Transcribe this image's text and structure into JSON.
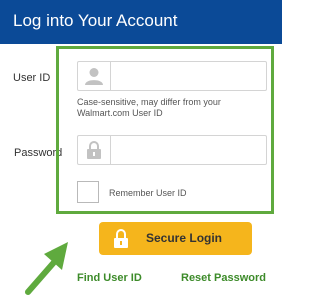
{
  "header": {
    "title": "Log into Your Account"
  },
  "form": {
    "user_id_label": "User ID",
    "user_id_value": "",
    "user_id_hint": "Case-sensitive, may differ from your Walmart.com User ID",
    "password_label": "Password",
    "password_value": "",
    "remember_label": "Remember User ID",
    "remember_checked": false
  },
  "actions": {
    "login_label": "Secure Login",
    "find_user_id": "Find User ID",
    "reset_password": "Reset Password"
  },
  "colors": {
    "header_bg": "#0b4a97",
    "highlight_border": "#5faa3e",
    "button_bg": "#f5b51c",
    "link": "#3d8b2a",
    "arrow": "#5faa3e"
  },
  "icons": [
    "user-icon",
    "lock-icon",
    "padlock-icon",
    "arrow-icon"
  ]
}
